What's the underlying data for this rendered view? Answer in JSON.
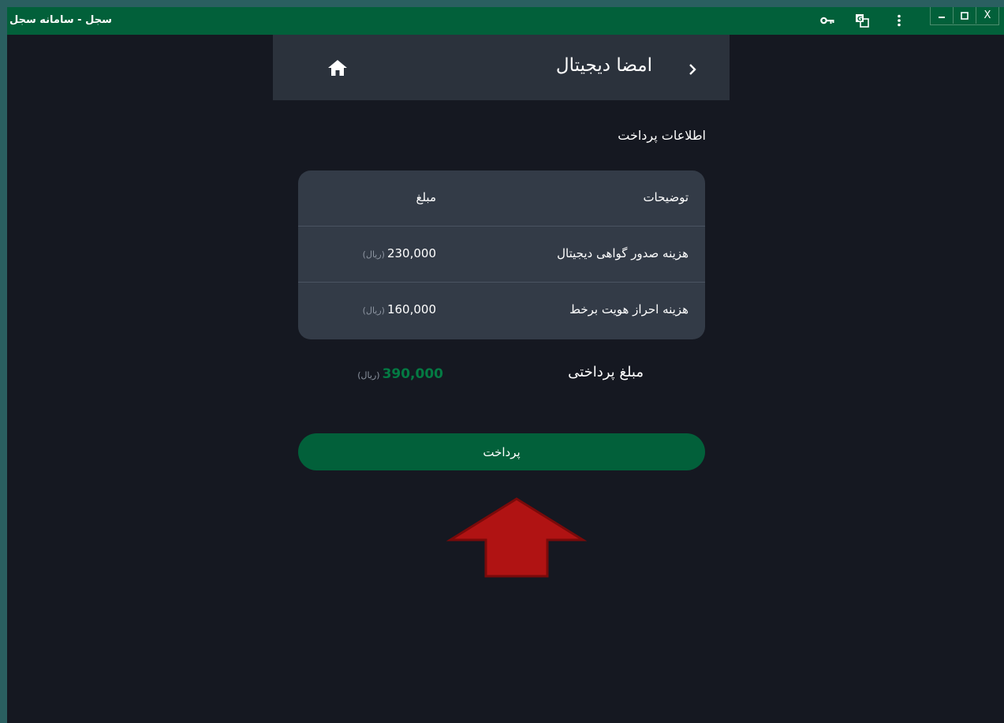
{
  "window": {
    "title": "سجل - سامانه سجل",
    "icons": [
      "key-icon",
      "translate-icon",
      "more-vert-icon"
    ],
    "controls": [
      "minimize",
      "maximize",
      "close"
    ],
    "close_glyph": "X"
  },
  "header": {
    "title": "امضا دیجیتال",
    "back_icon": "chevron-right-icon",
    "home_icon": "home-icon"
  },
  "section_title": "اطلاعات پرداخت",
  "table": {
    "headers": {
      "description": "توضیحات",
      "amount": "مبلغ"
    },
    "rows": [
      {
        "description": "هزینه صدور گواهی دیجیتال",
        "amount": "230,000",
        "unit": "(ریال)"
      },
      {
        "description": "هزینه احراز هویت برخط",
        "amount": "160,000",
        "unit": "(ریال)"
      }
    ]
  },
  "total": {
    "label": "مبلغ پرداختی",
    "amount": "390,000",
    "unit": "(ریال)"
  },
  "pay_button_label": "پرداخت",
  "colors": {
    "brand_green": "#02603a",
    "amount_green": "#047a43",
    "annotation_arrow": "#b01313"
  }
}
